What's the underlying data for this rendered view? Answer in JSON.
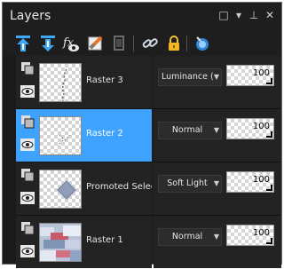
{
  "window": {
    "title": "Layers",
    "controls": {
      "restore": "□",
      "menu": "▾",
      "pin": "⊥",
      "close": "✕"
    }
  },
  "toolbar": {
    "icons": [
      "move-layer-up-icon",
      "move-layer-down-icon",
      "layer-properties-icon",
      "delete-layer-icon",
      "duplicate-layer-icon",
      "link-layer-icon",
      "lock-icon",
      "palette-options-icon"
    ]
  },
  "colors": {
    "panel": "#1e1e1e",
    "row": "#232323",
    "selected": "#3ea3ff",
    "toolbar_blue": "#3fa8f5"
  },
  "layers": [
    {
      "name": "Raster 3",
      "blend": "Luminance (L)",
      "opacity": "100",
      "selected": false,
      "visible": true
    },
    {
      "name": "Raster 2",
      "blend": "Normal",
      "opacity": "100",
      "selected": true,
      "visible": true
    },
    {
      "name": "Promoted Selection",
      "blend": "Soft Light",
      "opacity": "100",
      "selected": false,
      "visible": true
    },
    {
      "name": "Raster 1",
      "blend": "Normal",
      "opacity": "100",
      "selected": false,
      "visible": true
    }
  ]
}
